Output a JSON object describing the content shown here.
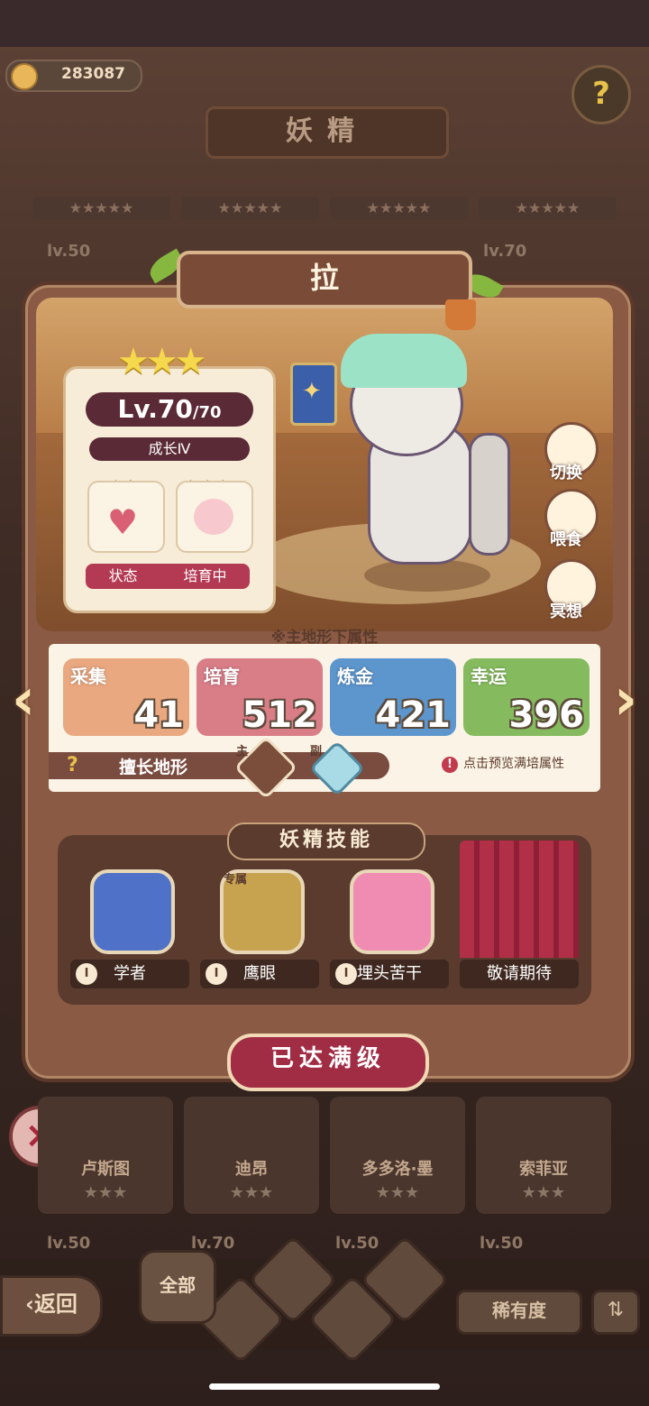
{
  "currency": {
    "amount": "283087"
  },
  "header": {
    "title": "妖精"
  },
  "background_list": {
    "levels": [
      "lv.50",
      "lv.70"
    ],
    "bottom_levels": [
      "lv.50",
      "lv.70",
      "lv.50",
      "lv.50"
    ],
    "names": [
      "卢斯图",
      "迪昂",
      "多多洛·墨",
      "索菲亚"
    ],
    "stars": "★★★"
  },
  "character": {
    "name": "拉",
    "stars": "★★★",
    "level": "Lv.70",
    "level_max": "/70",
    "growth": "成长Ⅳ",
    "intimacy_label": "亲密",
    "effort_label": "努力度",
    "status_label": "状态",
    "status_value": "培育中"
  },
  "side_buttons": {
    "switch": "切换",
    "feed": "喂食",
    "meditate": "冥想"
  },
  "attributes": {
    "caption": "※主地形下属性",
    "items": [
      {
        "name": "采集",
        "value": "41",
        "color": "#e9a880"
      },
      {
        "name": "培育",
        "value": "512",
        "color": "#d97d87"
      },
      {
        "name": "炼金",
        "value": "421",
        "color": "#5d95cd"
      },
      {
        "name": "幸运",
        "value": "396",
        "color": "#85bb5e"
      }
    ],
    "terrain_label": "擅长地形",
    "primary_tag": "主",
    "secondary_tag": "副",
    "preview_note": "点击预览满培属性",
    "warn_icon": "!"
  },
  "skills": {
    "title": "妖精技能",
    "exclusive_tag": "专属",
    "items": [
      {
        "num": "Ⅰ",
        "label": "学者",
        "icon": "shell-icon"
      },
      {
        "num": "Ⅰ",
        "label": "鹰眼",
        "icon": "bee-icon"
      },
      {
        "num": "Ⅰ",
        "label": "埋头苦干",
        "icon": "angry-face-icon"
      },
      {
        "label": "敬请期待",
        "icon": "curtain-icon"
      }
    ]
  },
  "max_button": "已达满级",
  "bottom_bar": {
    "back": "返回",
    "all": "全部",
    "rarity": "稀有度",
    "sort_icon": "sort-icon"
  }
}
